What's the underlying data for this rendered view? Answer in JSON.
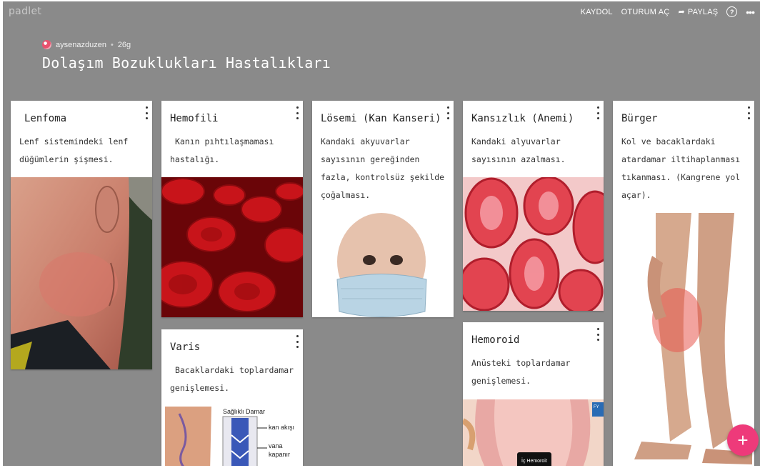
{
  "app": {
    "logo": "padlet"
  },
  "topbar": {
    "signup": "KAYDOL",
    "login": "OTURUM AÇ",
    "share": "PAYLAŞ",
    "help_icon": "question-circle-icon",
    "more_icon": "ellipsis-icon"
  },
  "author": {
    "name": "aysenazduzen",
    "separator": "•",
    "age": "26g"
  },
  "board": {
    "title": "Dolaşım Bozuklukları Hastalıkları",
    "background": "#8a8a8a"
  },
  "cards": {
    "lenfoma": {
      "title": "Lenfoma",
      "body": "Lenf sistemindeki lenf\ndüğümlerin şişmesi."
    },
    "hemofili": {
      "title": "Hemofili",
      "body": " Kanın pıhtılaşmaması\nhastalığı."
    },
    "losemi": {
      "title": "Lösemi (Kan Kanseri)",
      "body": "Kandaki akyuvarlar\nsayısının gereğinden\nfazla, kontrolsüz şekilde\nçoğalması."
    },
    "kansizlik": {
      "title": "Kansızlık (Anemi)",
      "body": "Kandaki alyuvarlar\nsayısının azalması."
    },
    "burger": {
      "title": "Bürger",
      "body": "Kol ve bacaklardaki\natardamar iltihaplanması\ntıkanması. (Kangrene yol\naçar)."
    },
    "varis": {
      "title": "Varis",
      "body": " Bacaklardaki toplardamar\ngenişlemesi.",
      "img_labels": {
        "healthy": "Sağlıklı Damar",
        "flow": "kan akışı",
        "valve": "vana\nkapanır"
      }
    },
    "hemoroid": {
      "title": "Hemoroid",
      "body": "Anüsteki toplardamar\ngenişlemesi.",
      "img_label": "İç Hemoroit",
      "img_tag": "FY"
    }
  },
  "fab": {
    "label": "+",
    "color": "#ee3a7a"
  }
}
